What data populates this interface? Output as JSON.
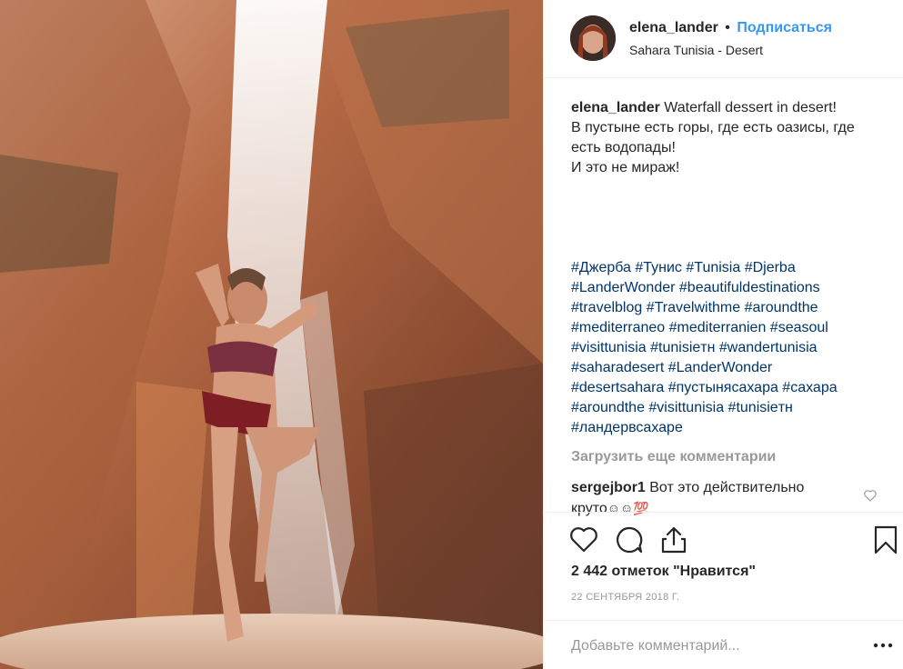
{
  "post": {
    "photo_label": "photo",
    "header": {
      "username": "elena_lander",
      "separator": "•",
      "follow_label": "Подписаться",
      "location": "Sahara Tunisia - Desert"
    },
    "caption": {
      "username": "elena_lander",
      "line1": " Waterfall dessert in desert!",
      "line2": "В пустыне есть горы, где есть оазисы, где",
      "line3": "есть водопады!",
      "line4": "И это не мираж!"
    },
    "hashtags": [
      "#Джерба #Тунис #Tunisia #Djerba",
      "#LanderWonder #beautifuldestinations",
      "#travelblog #Travelwithme #aroundthe",
      "#mediterraneo #mediterranien #seasoul",
      "#visittunisia #tunisieтн #wandertunisia",
      "#saharadesert #LanderWonder",
      "#desertsahara #пустынясахара #сахара",
      "#aroundthe #visittunisia #tunisieтн",
      "#ландервсахаре"
    ],
    "load_more_label": "Загрузить еще комментарии",
    "comment": {
      "username": "sergejbor1",
      "line1": " Вот это действительно",
      "line2": "круто",
      "emoji": "☺☺💯"
    },
    "likes": "2 442 отметок \"Нравится\"",
    "date": "22 СЕНТЯБРЯ 2018 Г.",
    "add_comment_placeholder": "Добавьте комментарий...",
    "icons": {
      "like": "heart-icon",
      "comment": "comment-icon",
      "share": "share-icon",
      "save": "bookmark-icon",
      "more": "more-options-icon",
      "comment_like": "heart-small-icon"
    },
    "colors": {
      "link": "#3897f0",
      "hashtag": "#003569",
      "muted": "#999999",
      "text": "#262626"
    }
  }
}
